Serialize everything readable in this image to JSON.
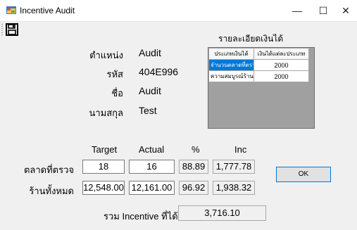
{
  "window": {
    "title": "Incentive Audit",
    "minimize": "—",
    "maximize": "☐",
    "close": "✕"
  },
  "employee": {
    "position_label": "ตำแหน่ง",
    "position_value": "Audit",
    "code_label": "รหัส",
    "code_value": "404E996",
    "firstname_label": "ชื่อ",
    "firstname_value": "Audit",
    "lastname_label": "นามสกุล",
    "lastname_value": "Test"
  },
  "detail_panel": {
    "title": "รายละเอียดเงินได้",
    "columns": [
      "ประเภทเงินได้",
      "เงินได้แต่ละประเภท"
    ],
    "rows": [
      {
        "type": "จำนวนตลาดที่ตรวจ",
        "amount": "2000",
        "selected": true
      },
      {
        "type": "ความสมบูรณ์ร้าน",
        "amount": "2000",
        "selected": false
      }
    ]
  },
  "summary": {
    "headers": {
      "target": "Target",
      "actual": "Actual",
      "percent": "%",
      "inc": "Inc"
    },
    "rows": [
      {
        "label": "ตลาดที่ตรวจ",
        "target": "18",
        "actual": "16",
        "percent": "88.89",
        "inc": "1,777.78"
      },
      {
        "label": "ร้านทั้งหมด",
        "target": "12,548.00",
        "actual": "12,161.00",
        "percent": "96.92",
        "inc": "1,938.32"
      }
    ],
    "total_label": "รวม Incentive ที่ได้",
    "total_value": "3,716.10"
  },
  "buttons": {
    "ok": "OK"
  },
  "icons": {
    "app": "app-window-icon",
    "save": "floppy-disk-icon"
  },
  "colors": {
    "selection": "#0078d7",
    "ok_border": "#0078d7"
  }
}
